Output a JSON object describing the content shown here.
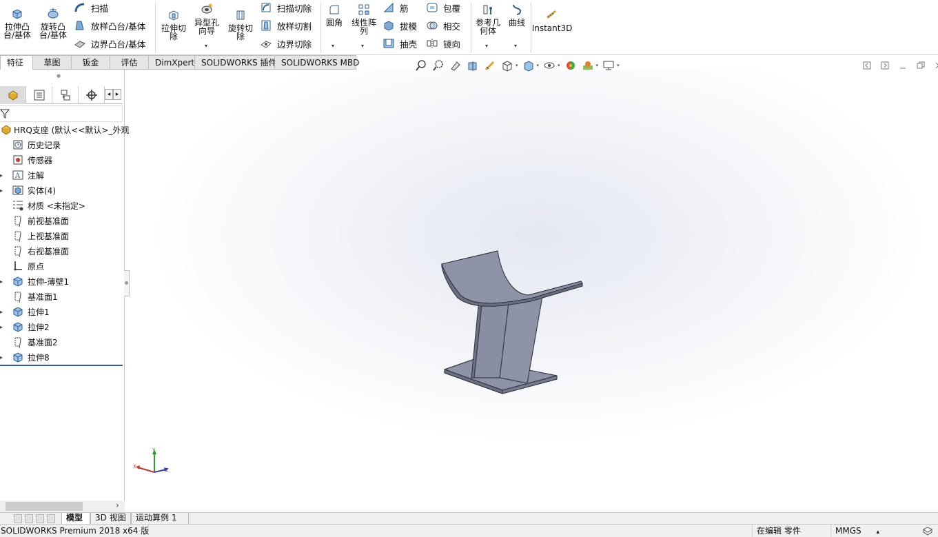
{
  "ribbon": {
    "extrude_boss": {
      "line1": "拉伸凸",
      "line2": "台/基体"
    },
    "revolve_boss": {
      "line1": "旋转凸",
      "line2": "台/基体"
    },
    "sweep": "扫描",
    "loft_boss": "放样凸台/基体",
    "boundary_boss": "边界凸台/基体",
    "extrude_cut": {
      "line1": "拉伸切",
      "line2": "除"
    },
    "hole_wizard": {
      "line1": "异型孔",
      "line2": "向导"
    },
    "revolve_cut": {
      "line1": "旋转切",
      "line2": "除"
    },
    "swept_cut": "扫描切除",
    "lofted_cut": "放样切割",
    "boundary_cut": "边界切除",
    "fillet": "圆角",
    "linear_pattern": {
      "line1": "线性阵",
      "line2": "列"
    },
    "rib": "筋",
    "draft": "拔模",
    "shell": "抽壳",
    "wrap": "包覆",
    "intersect": "相交",
    "mirror": "镜向",
    "ref_geometry": {
      "line1": "参考几",
      "line2": "何体"
    },
    "curves": "曲线",
    "instant3d": "Instant3D",
    "dropdown_glyph": "▾"
  },
  "tabs": [
    "特征",
    "草图",
    "钣金",
    "评估",
    "DimXpert",
    "SOLIDWORKS 插件",
    "SOLIDWORKS MBD"
  ],
  "panel": {
    "collapse_glyph": "●",
    "nav_left": "◂",
    "nav_right": "▸",
    "root_label": "HRQ支座  (默认<<默认>_外观",
    "items": [
      {
        "label": "历史记录",
        "icon": "history-icon",
        "expandable": false
      },
      {
        "label": "传感器",
        "icon": "sensor-icon",
        "expandable": false
      },
      {
        "label": "注解",
        "icon": "annotation-icon",
        "expandable": true
      },
      {
        "label": "实体(4)",
        "icon": "solid-bodies-icon",
        "expandable": true
      },
      {
        "label": "材质 <未指定>",
        "icon": "material-icon",
        "expandable": false
      },
      {
        "label": "前视基准面",
        "icon": "plane-icon",
        "expandable": false
      },
      {
        "label": "上视基准面",
        "icon": "plane-icon",
        "expandable": false
      },
      {
        "label": "右视基准面",
        "icon": "plane-icon",
        "expandable": false
      },
      {
        "label": "原点",
        "icon": "origin-icon",
        "expandable": false
      },
      {
        "label": "拉伸-薄壁1",
        "icon": "extrude-feature-icon",
        "expandable": true
      },
      {
        "label": "基准面1",
        "icon": "plane-icon",
        "expandable": false
      },
      {
        "label": "拉伸1",
        "icon": "extrude-feature-icon",
        "expandable": true
      },
      {
        "label": "拉伸2",
        "icon": "extrude-feature-icon",
        "expandable": true
      },
      {
        "label": "基准面2",
        "icon": "plane-icon",
        "expandable": false
      },
      {
        "label": "拉伸8",
        "icon": "extrude-feature-icon",
        "expandable": true
      }
    ],
    "scroll_right": "›"
  },
  "triad": {
    "x": "X",
    "y": "Y",
    "z": "Z"
  },
  "bottom_tabs": [
    "模型",
    "3D 视图",
    "运动算例 1"
  ],
  "status": {
    "product": "SOLIDWORKS Premium 2018 x64 版",
    "editing": "在编辑 零件",
    "units": "MMGS",
    "units_arrow": "▴"
  },
  "colors": {
    "model_face": "#8f93a8",
    "model_edge": "#3a3c46",
    "selection_line": "#2b5fb8"
  }
}
